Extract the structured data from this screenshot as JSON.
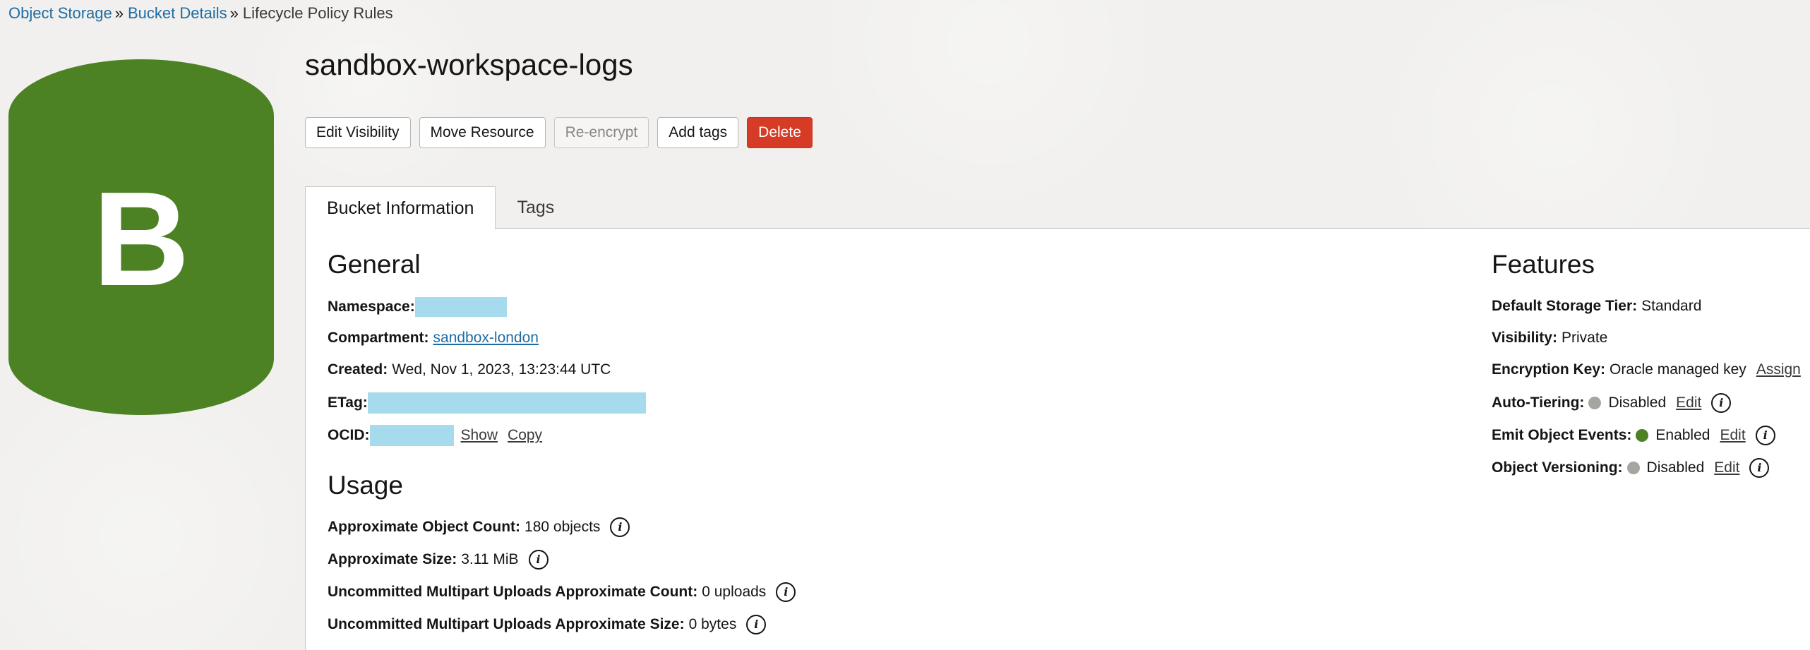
{
  "breadcrumb": {
    "items": [
      "Object Storage",
      "Bucket Details"
    ],
    "separator": "»",
    "current": "Lifecycle Policy Rules"
  },
  "badge": {
    "letter": "B",
    "color": "#4c8224"
  },
  "title": "sandbox-workspace-logs",
  "actions": {
    "edit_visibility": "Edit Visibility",
    "move_resource": "Move Resource",
    "re_encrypt": "Re-encrypt",
    "add_tags": "Add tags",
    "delete": "Delete"
  },
  "tabs": [
    "Bucket Information",
    "Tags"
  ],
  "general": {
    "heading": "General",
    "namespace_label": "Namespace:",
    "compartment_label": "Compartment:",
    "compartment_value": "sandbox-london",
    "created_label": "Created:",
    "created_value": "Wed, Nov 1, 2023, 13:23:44 UTC",
    "etag_label": "ETag:",
    "ocid_label": "OCID:",
    "show_link": "Show",
    "copy_link": "Copy"
  },
  "usage": {
    "heading": "Usage",
    "object_count_label": "Approximate Object Count:",
    "object_count_value": "180 objects",
    "size_label": "Approximate Size:",
    "size_value": "3.11 MiB",
    "multipart_count_label": "Uncommitted Multipart Uploads Approximate Count:",
    "multipart_count_value": "0 uploads",
    "multipart_size_label": "Uncommitted Multipart Uploads Approximate Size:",
    "multipart_size_value": "0 bytes"
  },
  "features": {
    "heading": "Features",
    "storage_tier_label": "Default Storage Tier:",
    "storage_tier_value": "Standard",
    "visibility_label": "Visibility:",
    "visibility_value": "Private",
    "encryption_label": "Encryption Key:",
    "encryption_value": "Oracle managed key",
    "assign_link": "Assign",
    "auto_tiering_label": "Auto-Tiering:",
    "auto_tiering_value": "Disabled",
    "emit_events_label": "Emit Object Events:",
    "emit_events_value": "Enabled",
    "versioning_label": "Object Versioning:",
    "versioning_value": "Disabled",
    "edit_link": "Edit"
  },
  "colors": {
    "enabled": "#4c8224",
    "disabled": "#a7a5a2",
    "danger": "#d63b25",
    "link": "#1e6ca3",
    "redaction": "#a5dbec"
  },
  "info_icon_glyph": "i"
}
